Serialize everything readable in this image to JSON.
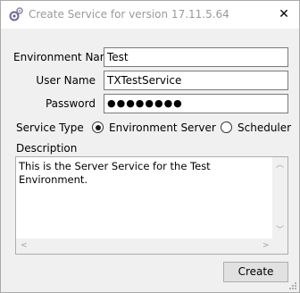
{
  "window": {
    "title": "Create Service for version 17.11.5.64",
    "close_glyph": "✕",
    "icon": "gear-service-icon"
  },
  "form": {
    "environment_name": {
      "label": "Environment Name",
      "value": "Test"
    },
    "user_name": {
      "label": "User Name",
      "value": "TXTestService"
    },
    "password": {
      "label": "Password",
      "value": "●●●●●●●●"
    },
    "service_type": {
      "label": "Service Type",
      "options": [
        {
          "label": "Environment Server",
          "checked": true
        },
        {
          "label": "Scheduler",
          "checked": false
        }
      ]
    },
    "description": {
      "label": "Description",
      "value": "This is the Server Service for the Test Environment."
    }
  },
  "buttons": {
    "create": "Create"
  },
  "colors": {
    "title_text": "#9a9a9a",
    "border": "#7a7a7a",
    "button_bg": "#e1e1e1"
  }
}
